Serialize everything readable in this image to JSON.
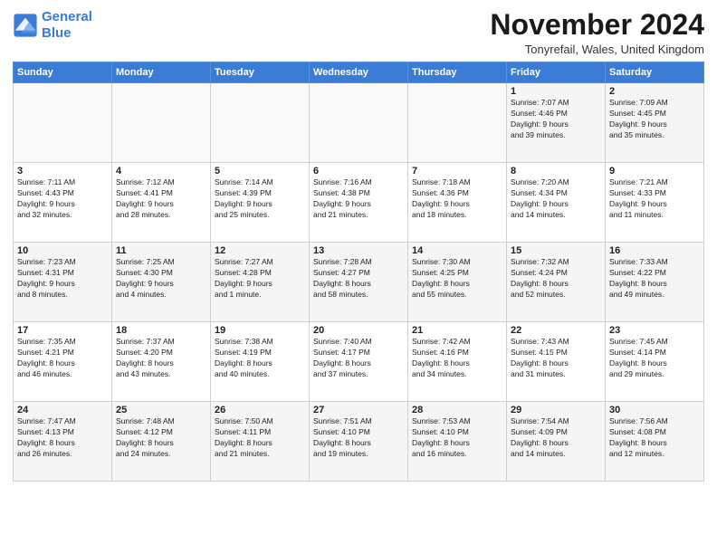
{
  "logo": {
    "line1": "General",
    "line2": "Blue"
  },
  "title": "November 2024",
  "subtitle": "Tonyrefail, Wales, United Kingdom",
  "weekdays": [
    "Sunday",
    "Monday",
    "Tuesday",
    "Wednesday",
    "Thursday",
    "Friday",
    "Saturday"
  ],
  "weeks": [
    [
      {
        "day": "",
        "info": ""
      },
      {
        "day": "",
        "info": ""
      },
      {
        "day": "",
        "info": ""
      },
      {
        "day": "",
        "info": ""
      },
      {
        "day": "",
        "info": ""
      },
      {
        "day": "1",
        "info": "Sunrise: 7:07 AM\nSunset: 4:46 PM\nDaylight: 9 hours\nand 39 minutes."
      },
      {
        "day": "2",
        "info": "Sunrise: 7:09 AM\nSunset: 4:45 PM\nDaylight: 9 hours\nand 35 minutes."
      }
    ],
    [
      {
        "day": "3",
        "info": "Sunrise: 7:11 AM\nSunset: 4:43 PM\nDaylight: 9 hours\nand 32 minutes."
      },
      {
        "day": "4",
        "info": "Sunrise: 7:12 AM\nSunset: 4:41 PM\nDaylight: 9 hours\nand 28 minutes."
      },
      {
        "day": "5",
        "info": "Sunrise: 7:14 AM\nSunset: 4:39 PM\nDaylight: 9 hours\nand 25 minutes."
      },
      {
        "day": "6",
        "info": "Sunrise: 7:16 AM\nSunset: 4:38 PM\nDaylight: 9 hours\nand 21 minutes."
      },
      {
        "day": "7",
        "info": "Sunrise: 7:18 AM\nSunset: 4:36 PM\nDaylight: 9 hours\nand 18 minutes."
      },
      {
        "day": "8",
        "info": "Sunrise: 7:20 AM\nSunset: 4:34 PM\nDaylight: 9 hours\nand 14 minutes."
      },
      {
        "day": "9",
        "info": "Sunrise: 7:21 AM\nSunset: 4:33 PM\nDaylight: 9 hours\nand 11 minutes."
      }
    ],
    [
      {
        "day": "10",
        "info": "Sunrise: 7:23 AM\nSunset: 4:31 PM\nDaylight: 9 hours\nand 8 minutes."
      },
      {
        "day": "11",
        "info": "Sunrise: 7:25 AM\nSunset: 4:30 PM\nDaylight: 9 hours\nand 4 minutes."
      },
      {
        "day": "12",
        "info": "Sunrise: 7:27 AM\nSunset: 4:28 PM\nDaylight: 9 hours\nand 1 minute."
      },
      {
        "day": "13",
        "info": "Sunrise: 7:28 AM\nSunset: 4:27 PM\nDaylight: 8 hours\nand 58 minutes."
      },
      {
        "day": "14",
        "info": "Sunrise: 7:30 AM\nSunset: 4:25 PM\nDaylight: 8 hours\nand 55 minutes."
      },
      {
        "day": "15",
        "info": "Sunrise: 7:32 AM\nSunset: 4:24 PM\nDaylight: 8 hours\nand 52 minutes."
      },
      {
        "day": "16",
        "info": "Sunrise: 7:33 AM\nSunset: 4:22 PM\nDaylight: 8 hours\nand 49 minutes."
      }
    ],
    [
      {
        "day": "17",
        "info": "Sunrise: 7:35 AM\nSunset: 4:21 PM\nDaylight: 8 hours\nand 46 minutes."
      },
      {
        "day": "18",
        "info": "Sunrise: 7:37 AM\nSunset: 4:20 PM\nDaylight: 8 hours\nand 43 minutes."
      },
      {
        "day": "19",
        "info": "Sunrise: 7:38 AM\nSunset: 4:19 PM\nDaylight: 8 hours\nand 40 minutes."
      },
      {
        "day": "20",
        "info": "Sunrise: 7:40 AM\nSunset: 4:17 PM\nDaylight: 8 hours\nand 37 minutes."
      },
      {
        "day": "21",
        "info": "Sunrise: 7:42 AM\nSunset: 4:16 PM\nDaylight: 8 hours\nand 34 minutes."
      },
      {
        "day": "22",
        "info": "Sunrise: 7:43 AM\nSunset: 4:15 PM\nDaylight: 8 hours\nand 31 minutes."
      },
      {
        "day": "23",
        "info": "Sunrise: 7:45 AM\nSunset: 4:14 PM\nDaylight: 8 hours\nand 29 minutes."
      }
    ],
    [
      {
        "day": "24",
        "info": "Sunrise: 7:47 AM\nSunset: 4:13 PM\nDaylight: 8 hours\nand 26 minutes."
      },
      {
        "day": "25",
        "info": "Sunrise: 7:48 AM\nSunset: 4:12 PM\nDaylight: 8 hours\nand 24 minutes."
      },
      {
        "day": "26",
        "info": "Sunrise: 7:50 AM\nSunset: 4:11 PM\nDaylight: 8 hours\nand 21 minutes."
      },
      {
        "day": "27",
        "info": "Sunrise: 7:51 AM\nSunset: 4:10 PM\nDaylight: 8 hours\nand 19 minutes."
      },
      {
        "day": "28",
        "info": "Sunrise: 7:53 AM\nSunset: 4:10 PM\nDaylight: 8 hours\nand 16 minutes."
      },
      {
        "day": "29",
        "info": "Sunrise: 7:54 AM\nSunset: 4:09 PM\nDaylight: 8 hours\nand 14 minutes."
      },
      {
        "day": "30",
        "info": "Sunrise: 7:56 AM\nSunset: 4:08 PM\nDaylight: 8 hours\nand 12 minutes."
      }
    ]
  ]
}
